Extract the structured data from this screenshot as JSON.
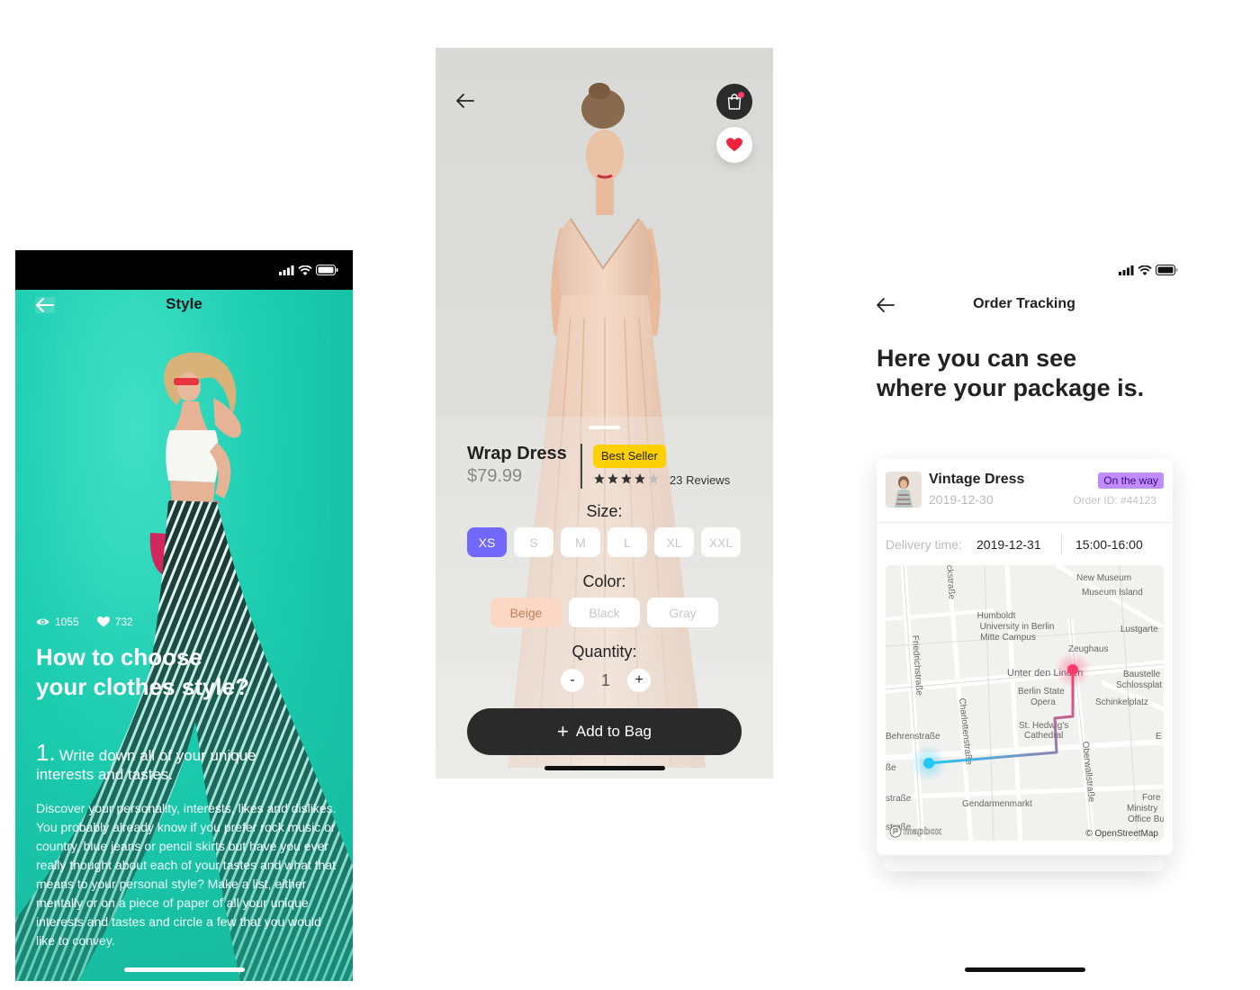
{
  "style_screen": {
    "title": "Style",
    "views": "1055",
    "likes": "732",
    "headline_line1": "How to choose",
    "headline_line2": "your clothes style?",
    "step_number": "1.",
    "step_text_line1": "Write down all of your unique",
    "step_text_line2": "interests and tastes.",
    "body": "Discover your personality, interests, likes and dislikes. You probably already know if you prefer rock music or country, blue jeans or pencil skirts but have you ever really thought about each of your tastes and what that means to your personal style? Make a list, either mentally or on a piece of paper of all your unique interests and tastes and circle a few that you would like to convey.",
    "icons": [
      "back-arrow-icon",
      "signal-icon",
      "wifi-icon",
      "battery-icon",
      "eye-icon",
      "heart-icon"
    ],
    "accent_color": "#1ec9ad"
  },
  "product_screen": {
    "name": "Wrap Dress",
    "price": "$79.99",
    "badge": "Best Seller",
    "rating": 4,
    "rating_max": 5,
    "reviews": "23 Reviews",
    "size_label": "Size:",
    "sizes": [
      {
        "label": "XS",
        "selected": true
      },
      {
        "label": "S",
        "selected": false
      },
      {
        "label": "M",
        "selected": false
      },
      {
        "label": "L",
        "selected": false
      },
      {
        "label": "XL",
        "selected": false
      },
      {
        "label": "XXL",
        "selected": false
      }
    ],
    "color_label": "Color:",
    "colors": [
      {
        "label": "Beige",
        "selected": true
      },
      {
        "label": "Black",
        "selected": false
      },
      {
        "label": "Gray",
        "selected": false
      }
    ],
    "quantity_label": "Quantity:",
    "quantity_minus": "-",
    "quantity": "1",
    "quantity_plus": "+",
    "cta": "Add to Bag",
    "cta_icon": "+",
    "icons": [
      "back-arrow-icon",
      "shopping-bag-icon",
      "heart-icon",
      "star-icon"
    ],
    "colors_hex": {
      "size_selected": "#7268ff",
      "badge": "#ffd000",
      "color_selected": "#fbd8c4",
      "cta": "#2a2a2a"
    }
  },
  "tracking_screen": {
    "title": "Order Tracking",
    "headline_line1": "Here you can see",
    "headline_line2": "where your package is.",
    "item_name": "Vintage Dress",
    "item_date": "2019-12-30",
    "status": "On the way",
    "order_id": "Order ID: #44123",
    "delivery_label": "Delivery time:",
    "delivery_date": "2019-12-31",
    "delivery_time": "15:00-16:00",
    "map_labels": {
      "new_museum": "New Museum",
      "museum_island": "Museum Island",
      "humboldt1": "Humboldt",
      "humboldt2": "University in Berlin",
      "humboldt3": "Mitte Campus",
      "lustgarten": "Lustgarte",
      "zeughaus": "Zeughaus",
      "unter": "Unter den Linden",
      "baustelle1": "Baustelle",
      "baustelle2": "Schlossplat",
      "state1": "Berlin State",
      "state2": "Opera",
      "schinkel": "Schinkelplatz",
      "friedrich": "Friedrichstraße",
      "charlotten": "Charlottenstraße",
      "behren": "Behrenstraße",
      "hedwig1": "St. Hedwig's",
      "hedwig2": "Cathedral",
      "oberwall": "Oberwallstraße",
      "strasse1": "ße",
      "strasse2": "straße",
      "strasse3": "straße",
      "gendarmen": "Gendarmenmarkt",
      "fore1": "Fore",
      "fore2": "Ministry",
      "fore3": "Office Bu",
      "top_street": "ckstraße",
      "e_label": "E",
      "attribution": "© OpenStreetMap",
      "mapbox": "mapbox"
    },
    "icons": [
      "signal-icon",
      "wifi-icon",
      "battery-icon",
      "back-arrow-icon",
      "origin-pin-icon",
      "destination-pin-icon"
    ],
    "colors_hex": {
      "status_tag": "#c08cff",
      "route_start": "#23c7f5",
      "route_end": "#ff3b6a"
    }
  }
}
